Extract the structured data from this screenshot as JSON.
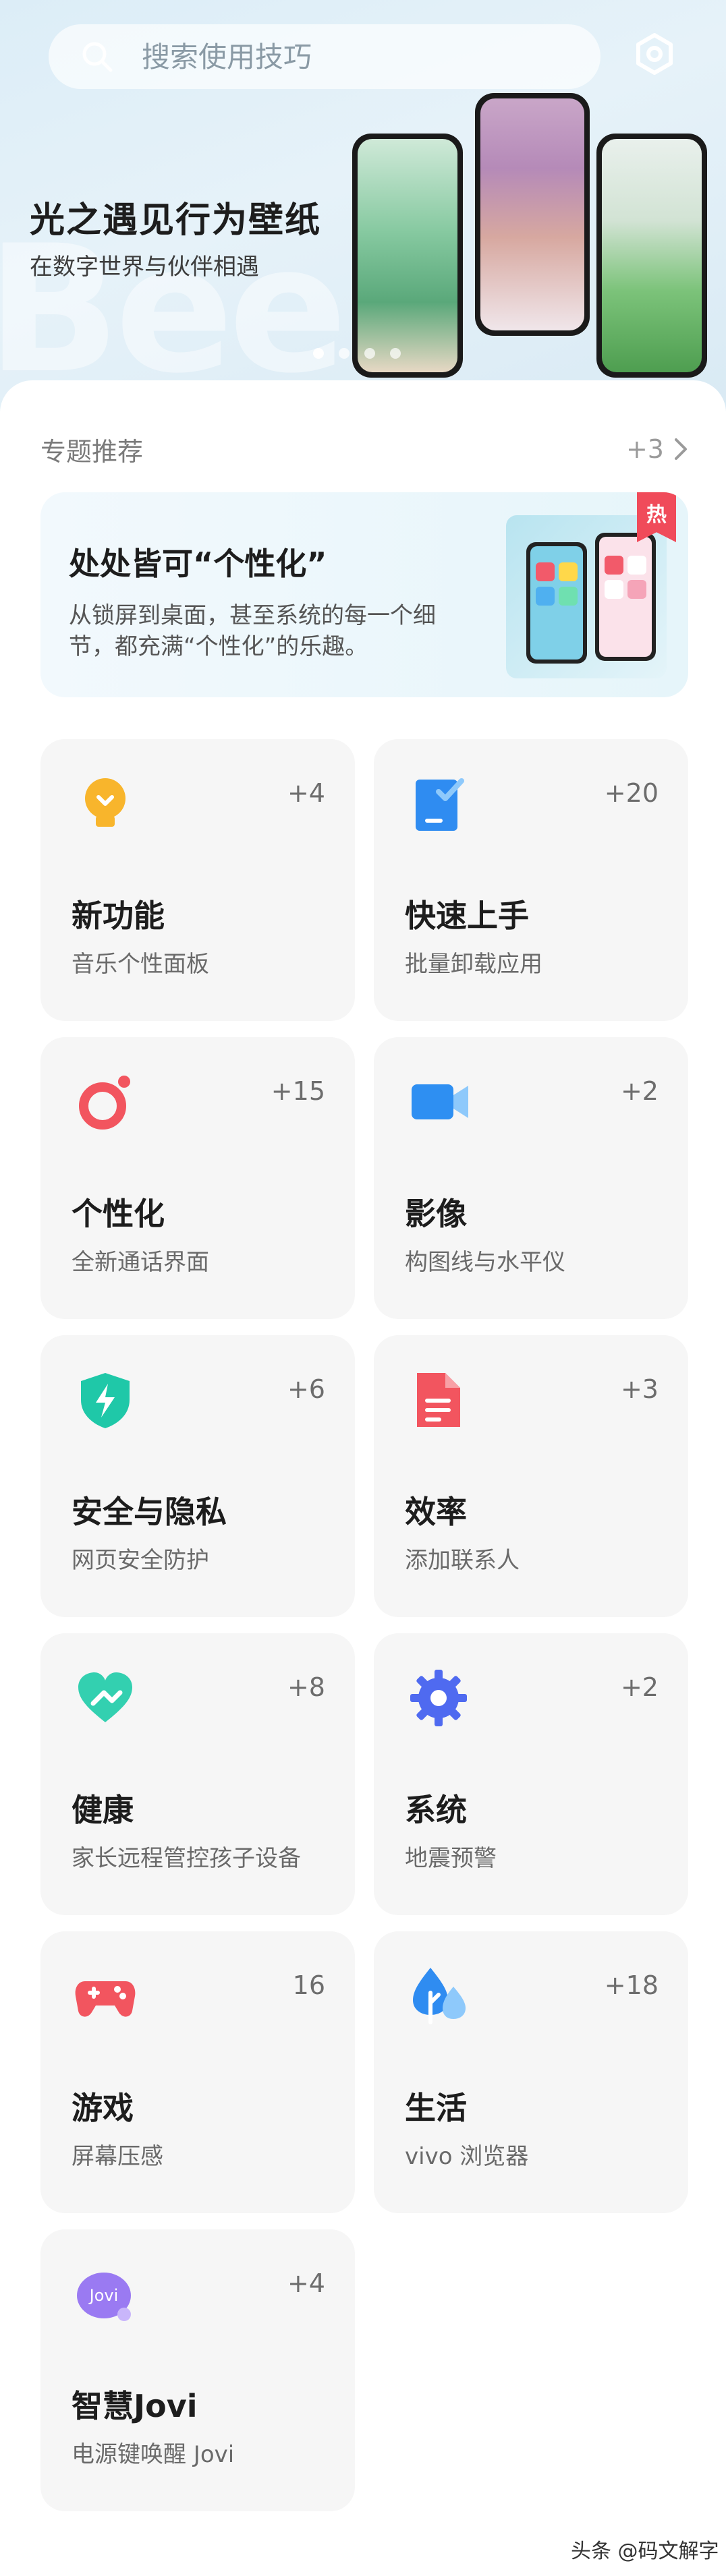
{
  "search": {
    "placeholder": "搜索使用技巧"
  },
  "banner": {
    "title": "光之遇见行为壁纸",
    "subtitle": "在数字世界与伙伴相遇",
    "watermark": "Bee",
    "slide_count": 4,
    "active_slide": 0
  },
  "topics": {
    "title": "专题推荐",
    "more": "+3",
    "feature": {
      "title": "处处皆可“个性化”",
      "description": "从锁屏到桌面，甚至系统的每一个细节，都充满“个性化”的乐趣。",
      "badge": "热"
    }
  },
  "categories": [
    {
      "name": "新功能",
      "sub": "音乐个性面板",
      "count": "+4",
      "icon": "lightbulb-icon",
      "color": "#f8b52c"
    },
    {
      "name": "快速上手",
      "sub": "批量卸载应用",
      "count": "+20",
      "icon": "document-check-icon",
      "color": "#2f8cf1"
    },
    {
      "name": "个性化",
      "sub": "全新通话界面",
      "count": "+15",
      "icon": "ring-icon",
      "color": "#f2555f"
    },
    {
      "name": "影像",
      "sub": "构图线与水平仪",
      "count": "+2",
      "icon": "video-camera-icon",
      "color": "#2e8ff2"
    },
    {
      "name": "安全与隐私",
      "sub": "网页安全防护",
      "count": "+6",
      "icon": "shield-bolt-icon",
      "color": "#1fc8a8"
    },
    {
      "name": "效率",
      "sub": "添加联系人",
      "count": "+3",
      "icon": "file-icon",
      "color": "#f2555f"
    },
    {
      "name": "健康",
      "sub": "家长远程管控孩子设备",
      "count": "+8",
      "icon": "heart-icon",
      "color": "#33d0b0"
    },
    {
      "name": "系统",
      "sub": "地震预警",
      "count": "+2",
      "icon": "gear-icon",
      "color": "#4f6af0"
    },
    {
      "name": "游戏",
      "sub": "屏幕压感",
      "count": "16",
      "icon": "gamepad-icon",
      "color": "#f2555f"
    },
    {
      "name": "生活",
      "sub": "vivo 浏览器",
      "count": "+18",
      "icon": "tree-icon",
      "color": "#2f8cf1"
    },
    {
      "name": "智慧Jovi",
      "sub": "电源键唤醒 Jovi",
      "count": "+4",
      "icon": "jovi-icon",
      "color": "#9a7af2"
    }
  ],
  "footer": {
    "watermark": "头条 @码文解字"
  }
}
